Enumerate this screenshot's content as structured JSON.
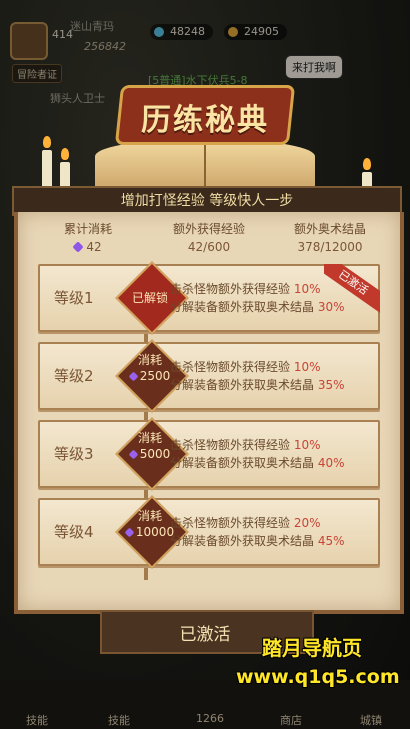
{
  "hud": {
    "level": "414",
    "power": "256842",
    "player_name": "迷山青玛",
    "gems": "48248",
    "gold": "24905",
    "adventure_btn": "冒险者证"
  },
  "background": {
    "enemy_label": "狮头人卫士",
    "speech": "来打我啊",
    "stage": "[5普通]水下伏兵5-8"
  },
  "manual": {
    "title": "历练秘典",
    "subtitle": "增加打怪经验 等级快人一步"
  },
  "stats": [
    {
      "label": "累计消耗",
      "value": "42"
    },
    {
      "label": "额外获得经验",
      "value": "42/600"
    },
    {
      "label": "额外奥术结晶",
      "value": "378/12000"
    }
  ],
  "levels": [
    {
      "name": "等级1",
      "status": "已解锁",
      "exp_text": "击杀怪物额外获得经验",
      "exp_pct": "10%",
      "crystal_text": "分解装备额外获取奥术结晶",
      "crystal_pct": "30%",
      "ribbon": "已激活"
    },
    {
      "name": "等级2",
      "cost_label": "消耗",
      "cost": "2500",
      "exp_text": "击杀怪物额外获得经验",
      "exp_pct": "10%",
      "crystal_text": "分解装备额外获取奥术结晶",
      "crystal_pct": "35%"
    },
    {
      "name": "等级3",
      "cost_label": "消耗",
      "cost": "5000",
      "exp_text": "击杀怪物额外获得经验",
      "exp_pct": "10%",
      "crystal_text": "分解装备额外获取奥术结晶",
      "crystal_pct": "40%"
    },
    {
      "name": "等级4",
      "cost_label": "消耗",
      "cost": "10000",
      "exp_text": "击杀怪物额外获得经验",
      "exp_pct": "20%",
      "crystal_text": "分解装备额外获取奥术结晶",
      "crystal_pct": "45%"
    }
  ],
  "activated_button": "已激活",
  "navbar": {
    "items": [
      "技能",
      "技能",
      "1266",
      "商店",
      "城镇"
    ]
  },
  "watermark": {
    "line1": "踏月导航页",
    "line2": "www.q1q5.com"
  },
  "colors": {
    "accent_red": "#c74536",
    "panel": "#e8d7b7",
    "gem_purple": "#8f57e6"
  }
}
